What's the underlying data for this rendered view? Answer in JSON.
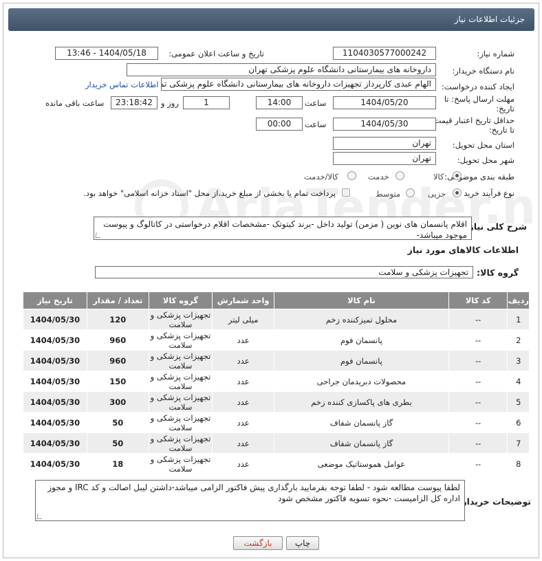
{
  "header": {
    "title": "جزئیات اطلاعات نیاز"
  },
  "fields": {
    "need_number_label": "شماره نیاز:",
    "need_number": "1104030577000242",
    "announce_label": "تاریخ و ساعت اعلان عمومی:",
    "announce_value": "1404/05/18 - 13:46",
    "buyer_label": "نام دستگاه خریدار:",
    "buyer_value": "داروخانه های بیمارستانی دانشگاه علوم پزشکی تهران",
    "creator_label": "ایجاد کننده درخواست:",
    "creator_value": "الهام عبدی کارپرداز تجهیزات داروخانه های بیمارستانی دانشگاه علوم پزشکی تم",
    "contact_link": "اطلاعات تماس خریدار",
    "deadline_label_1": "مهلت ارسال پاسخ: تا",
    "deadline_label_2": "تاریخ:",
    "deadline_date": "1404/05/20",
    "hour_label": "ساعت",
    "deadline_time": "14:00",
    "days_value": "1",
    "days_label": "روز و",
    "remaining_time": "23:18:42",
    "remaining_label": "ساعت باقی مانده",
    "min_validity_label_1": "حداقل تاریخ اعتبار قیمت:",
    "min_validity_label_2": "تا تاریخ:",
    "validity_date": "1404/05/30",
    "validity_time": "00:00",
    "province_label": "استان محل تحویل:",
    "province_value": "تهران",
    "city_label": "شهر محل تحویل:",
    "city_value": "تهران",
    "category_label": "طبقه بندی موضوعی:",
    "category_options": [
      "کالا",
      "خدمت",
      "کالا/خدمت"
    ],
    "category_selected": "کالا",
    "process_label": "نوع فرآیند خرید :",
    "process_options": [
      "جزیی",
      "متوسط"
    ],
    "process_selected": "جزیی",
    "payment_note": "پرداخت تمام یا بخشی از مبلغ خرید،از محل \"اسناد خزانه اسلامی\" خواهد بود."
  },
  "summary": {
    "label": "شرح کلی نیاز:",
    "text": "اقلام پانسمان های نوین ( مزمن) تولید داخل -برند کیتوتک -مشخصات اقلام درخواستی در کاتالوگ و پیوست موجود میباشد-"
  },
  "goods_section": {
    "title": "اطلاعات کالاهای مورد نیاز",
    "group_label": "گروه کالا:",
    "group_value": "تجهیزات پزشکی و سلامت"
  },
  "table": {
    "headers": [
      "ردیف",
      "کد کالا",
      "نام کالا",
      "واحد شمارش",
      "گروه کالا",
      "تعداد / مقدار",
      "تاریخ نیاز"
    ],
    "rows": [
      {
        "row": "1",
        "code": "--",
        "name": "محلول تمیزکننده زخم",
        "unit": "میلی لیتر",
        "group_1": "تجهیزات پزشکی و",
        "group_2": "سلامت",
        "qty": "120",
        "date": "1404/05/30"
      },
      {
        "row": "2",
        "code": "--",
        "name": "پانسمان فوم",
        "unit": "عدد",
        "group_1": "تجهیزات پزشکی و",
        "group_2": "سلامت",
        "qty": "960",
        "date": "1404/05/30"
      },
      {
        "row": "3",
        "code": "--",
        "name": "پانسمان فوم",
        "unit": "عدد",
        "group_1": "تجهیزات پزشکی و",
        "group_2": "سلامت",
        "qty": "960",
        "date": "1404/05/30"
      },
      {
        "row": "4",
        "code": "--",
        "name": "محصولات دبریدمان جراحی",
        "unit": "عدد",
        "group_1": "تجهیزات پزشکی و",
        "group_2": "سلامت",
        "qty": "150",
        "date": "1404/05/30"
      },
      {
        "row": "5",
        "code": "--",
        "name": "بطری های پاکسازی کننده زخم",
        "unit": "عدد",
        "group_1": "تجهیزات پزشکی و",
        "group_2": "سلامت",
        "qty": "300",
        "date": "1404/05/30"
      },
      {
        "row": "6",
        "code": "--",
        "name": "گاز پانسمان شفاف",
        "unit": "عدد",
        "group_1": "تجهیزات پزشکی و",
        "group_2": "سلامت",
        "qty": "50",
        "date": "1404/05/30"
      },
      {
        "row": "7",
        "code": "--",
        "name": "گاز پانسمان شفاف",
        "unit": "عدد",
        "group_1": "تجهیزات پزشکی و",
        "group_2": "سلامت",
        "qty": "50",
        "date": "1404/05/30"
      },
      {
        "row": "8",
        "code": "--",
        "name": "عوامل هموستاتیک موضعی",
        "unit": "عدد",
        "group_1": "تجهیزات پزشکی و",
        "group_2": "سلامت",
        "qty": "18",
        "date": "1404/05/30"
      }
    ]
  },
  "notes": {
    "label": "توضیحات خریدار:",
    "text": "لطفا پیوست مطالعه شود - لطفا توجه بفرمایید بارگذاری پیش فاکتور الزامی میباشد-داشتن لیبل اصالت و کد IRC و مجوز اداره کل الزامیست -نحوه تسویه فاکتور مشخص شود"
  },
  "buttons": {
    "print": "چاپ",
    "back": "بازگشت"
  },
  "watermark": "AriaTender.net",
  "colors": {
    "header": "#4b5e74",
    "link": "#1f4fa3",
    "table_header": "#8a8a8a",
    "back_text": "#c0392b"
  }
}
